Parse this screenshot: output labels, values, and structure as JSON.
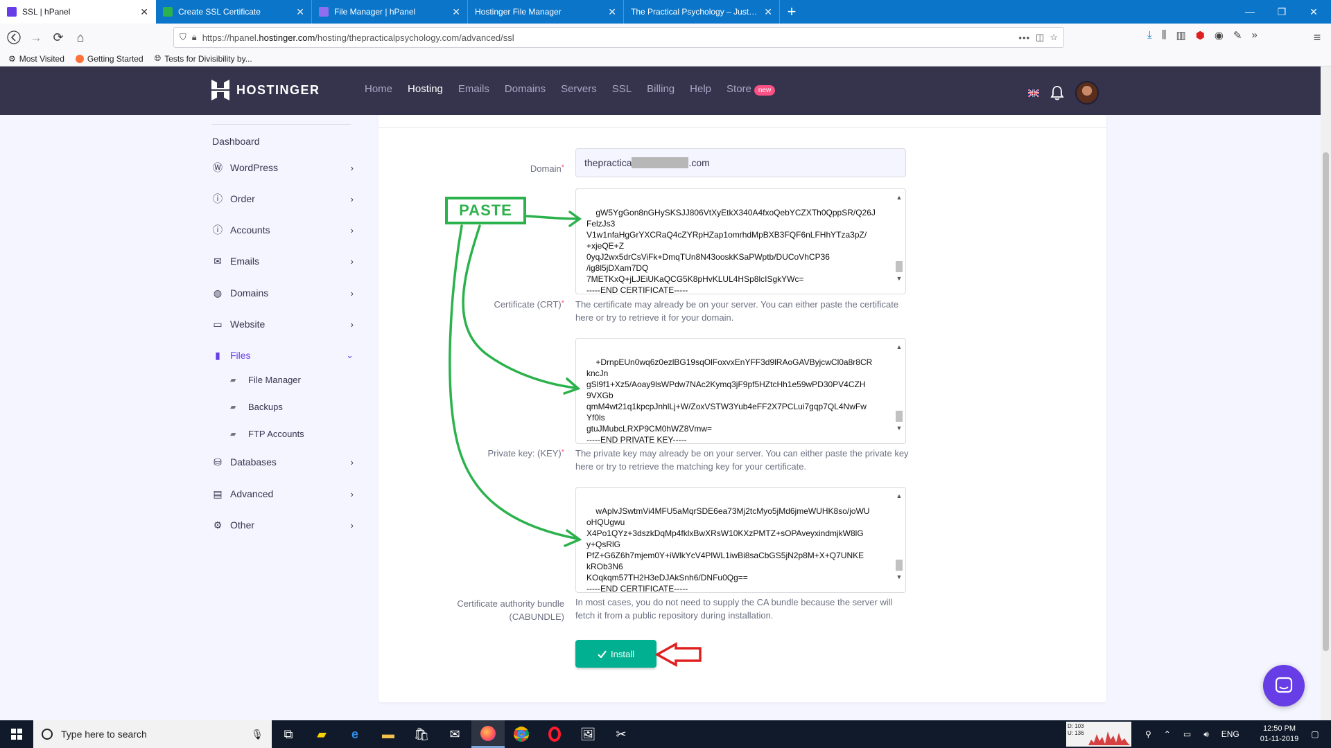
{
  "browser": {
    "tabs": [
      {
        "title": "SSL | hPanel",
        "active": true,
        "favicon_color": "#673de6"
      },
      {
        "title": "Create SSL Certificate",
        "active": false,
        "favicon_color": "#2bb24c"
      },
      {
        "title": "File Manager | hPanel",
        "active": false,
        "favicon_color": "#673de6"
      },
      {
        "title": "Hostinger File Manager",
        "active": false,
        "favicon_color": "#0a75c9"
      },
      {
        "title": "The Practical Psychology – Just an",
        "active": false,
        "favicon_color": "#0a75c9"
      }
    ],
    "url_prefix": "https://hpanel.",
    "url_host": "hostinger.com",
    "url_path": "/hosting/thepracticalpsychology.com/advanced/ssl",
    "bookmarks": [
      "Most Visited",
      "Getting Started",
      "Tests for Divisibility by..."
    ]
  },
  "header": {
    "brand": "HOSTINGER",
    "nav": [
      {
        "label": "Home",
        "active": false
      },
      {
        "label": "Hosting",
        "active": true
      },
      {
        "label": "Emails",
        "active": false
      },
      {
        "label": "Domains",
        "active": false
      },
      {
        "label": "Servers",
        "active": false
      },
      {
        "label": "SSL",
        "active": false
      },
      {
        "label": "Billing",
        "active": false
      },
      {
        "label": "Help",
        "active": false
      },
      {
        "label": "Store",
        "active": false
      }
    ],
    "store_badge": "new"
  },
  "sidebar": {
    "dashboard": "Dashboard",
    "items": [
      {
        "label": "WordPress",
        "icon": "wordpress-icon"
      },
      {
        "label": "Order",
        "icon": "info-icon"
      },
      {
        "label": "Accounts",
        "icon": "info-icon"
      },
      {
        "label": "Emails",
        "icon": "envelope-icon"
      },
      {
        "label": "Domains",
        "icon": "globe-icon"
      },
      {
        "label": "Website",
        "icon": "monitor-icon"
      },
      {
        "label": "Files",
        "icon": "file-icon"
      },
      {
        "label": "Databases",
        "icon": "database-icon"
      },
      {
        "label": "Advanced",
        "icon": "toolbox-icon"
      },
      {
        "label": "Other",
        "icon": "gears-icon"
      }
    ],
    "files_sub": [
      "File Manager",
      "Backups",
      "FTP Accounts"
    ]
  },
  "form": {
    "domain_label": "Domain",
    "domain_prefix": "thepractica",
    "domain_suffix": ".com",
    "crt_label": "Certificate (CRT)",
    "crt_text": "gW5YgGon8nGHySKSJJ806VtXyEtkX340A4fxoQebYCZXTh0QppSR/Q26J\nFelzJs3\nV1w1nfaHgGrYXCRaQ4cZYRpHZap1omrhdMpBXB3FQF6nLFHhYTza3pZ/\n+xjeQE+Z\n0yqJ2wx5drCsViFk+DmqTUn8N43ooskKSaPWptb/DUCoVhCP36\n/ig8l5jDXam7DQ\n7METKxQ+jLJEiUKaQCG5K8pHvKLUL4HSp8lcISgkYWc=\n-----END CERTIFICATE-----",
    "crt_help": "The certificate may already be on your server. You can either paste the certificate here or try to retrieve it for your domain.",
    "key_label": "Private key: (KEY)",
    "key_text": "+DrnpEUn0wq6z0ezlBG19sqOlFoxvxEnYFF3d9lRAoGAVByjcwCl0a8r8CR\nkncJn\ngSl9f1+Xz5/Aoay9lsWPdw7NAc2Kymq3jF9pf5HZtcHh1e59wPD30PV4CZH\n9VXGb\nqmM4wt21q1kpcpJnhlLj+W/ZoxVSTW3Yub4eFF2X7PCLui7gqp7QL4NwFw\nYf0ls\ngtuJMubcLRXP9CM0hWZ8Vmw=\n-----END PRIVATE KEY-----",
    "key_help": "The private key may already be on your server. You can either paste the private key here or try to retrieve the matching key for your certificate.",
    "ca_label_1": "Certificate authority bundle",
    "ca_label_2": "(CABUNDLE)",
    "ca_text": "wAplvJSwtmVi4MFU5aMqrSDE6ea73Mj2tcMyo5jMd6jmeWUHK8so/joWU\noHQUgwu\nX4Po1QYz+3dszkDqMp4fklxBwXRsW10KXzPMTZ+sOPAveyxindmjkW8lG\ny+QsRlG\nPfZ+G6Z6h7mjem0Y+iWlkYcV4PlWL1iwBi8saCbGS5jN2p8M+X+Q7UNKE\nkROb3N6\nKOqkqm57TH2H3eDJAkSnh6/DNFu0Qg==\n-----END CERTIFICATE-----",
    "ca_help": "In most cases, you do not need to supply the CA bundle because the server will fetch it from a public repository during installation.",
    "install_label": "Install"
  },
  "annotations": {
    "paste": "PASTE",
    "arrow_color": "#2bb24c",
    "pointer_color": "#e02020"
  },
  "taskbar": {
    "search_placeholder": "Type here to search",
    "language": "ENG",
    "time": "12:50 PM",
    "date": "01-11-2019",
    "disk_d": "D: 103",
    "disk_u": "U: 136"
  },
  "colors": {
    "brand_purple": "#673de6",
    "header_bg": "#36344d",
    "install_green": "#00b090",
    "browser_blue": "#0a75c9"
  }
}
